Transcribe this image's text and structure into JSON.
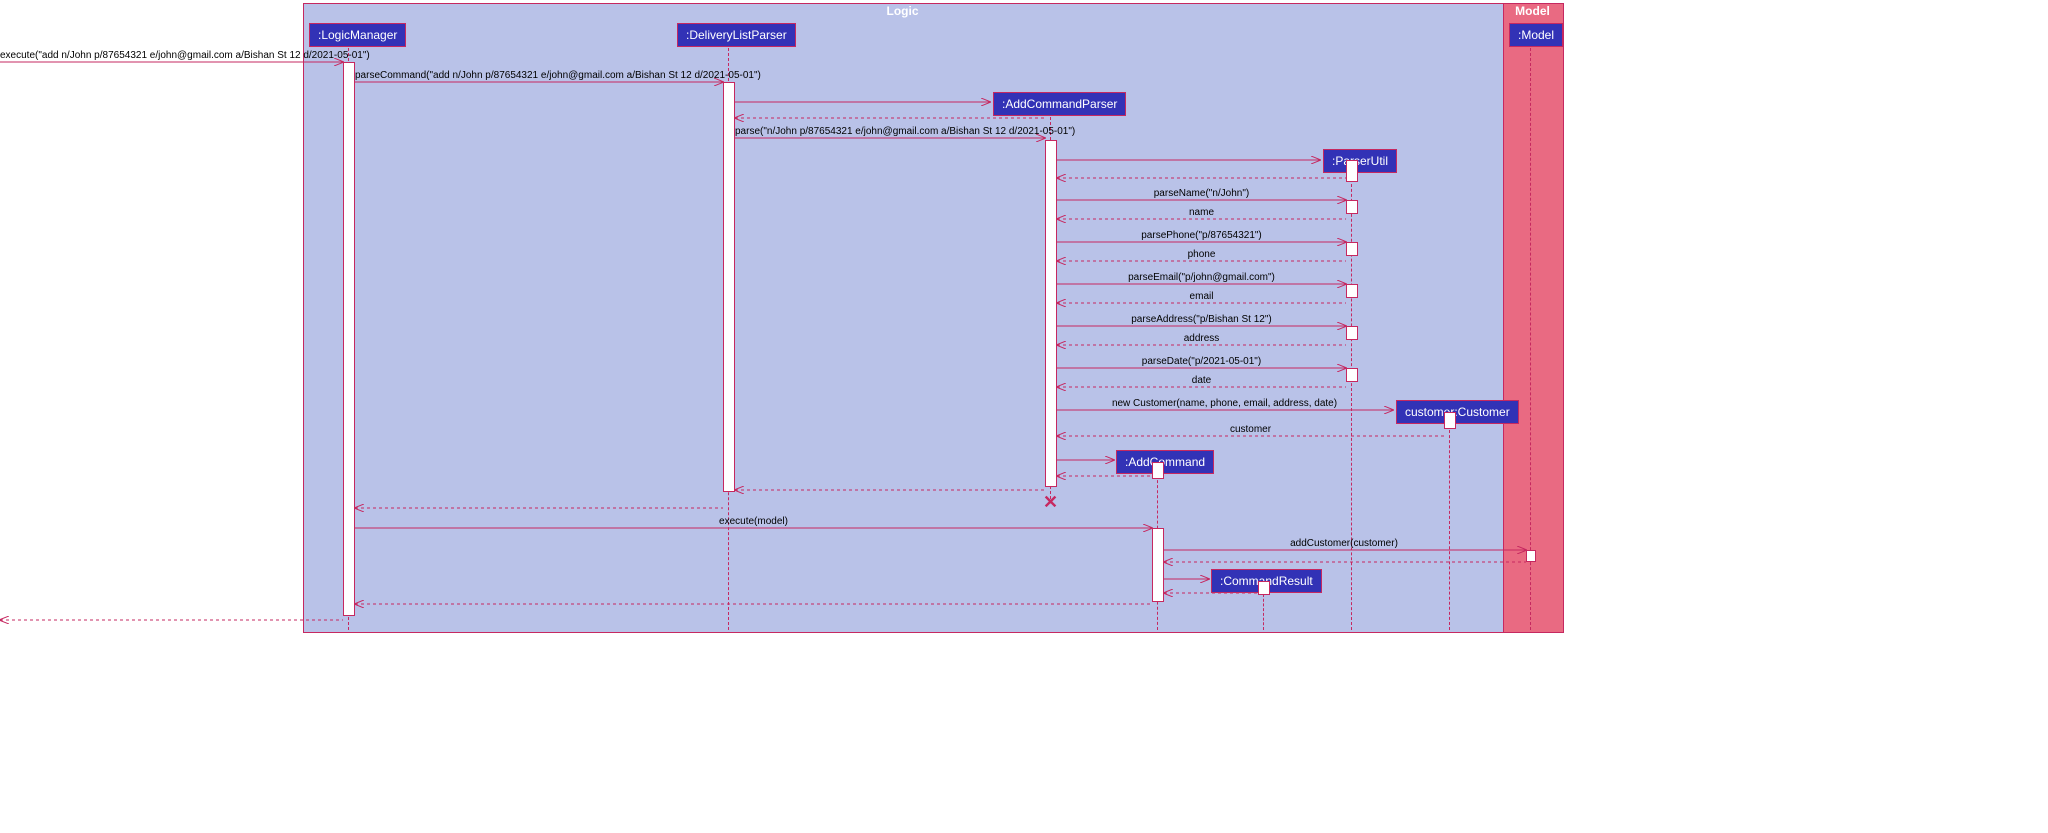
{
  "frames": {
    "logic": "Logic",
    "model": "Model"
  },
  "lifelines": {
    "logicManager": ":LogicManager",
    "deliveryListParser": ":DeliveryListParser",
    "addCommandParser": ":AddCommandParser",
    "parserUtil": ":ParserUtil",
    "customer": "customer:Customer",
    "addCommand": ":AddCommand",
    "commandResult": ":CommandResult",
    "modelHead": ":Model"
  },
  "messages": {
    "execute1": "execute(\"add n/John p/87654321 e/john@gmail.com a/Bishan St 12 d/2021-05-01\")",
    "parseCommand": "parseCommand(\"add n/John p/87654321 e/john@gmail.com a/Bishan St 12 d/2021-05-01\")",
    "parse": "parse(\"n/John p/87654321 e/john@gmail.com a/Bishan St 12 d/2021-05-01\")",
    "parseName": "parseName(\"n/John\")",
    "name": "name",
    "parsePhone": "parsePhone(\"p/87654321\")",
    "phone": "phone",
    "parseEmail": "parseEmail(\"p/john@gmail.com\")",
    "email": "email",
    "parseAddress": "parseAddress(\"p/Bishan St 12\")",
    "address": "address",
    "parseDate": "parseDate(\"p/2021-05-01\")",
    "date": "date",
    "newCustomer": "new Customer(name, phone, email, address, date)",
    "customerReturn": "customer",
    "executeModel": "execute(model)",
    "addCustomer": "addCustomer(customer)"
  }
}
